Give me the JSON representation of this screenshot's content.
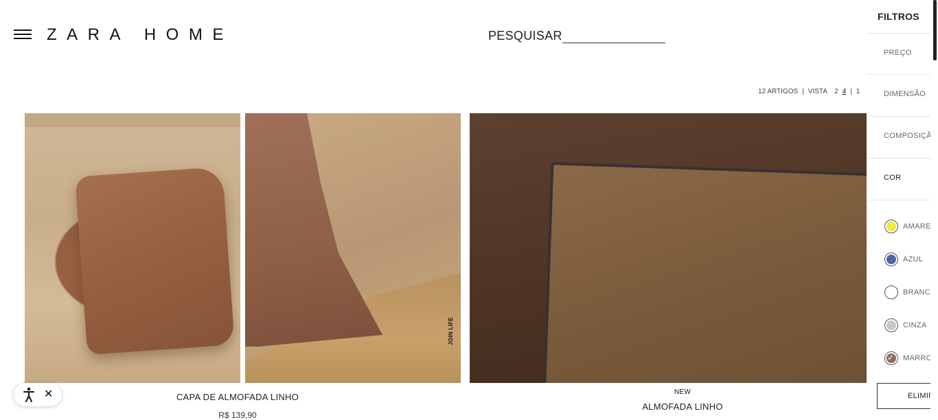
{
  "header": {
    "logo": "ZARA HOME",
    "search_label": "PESQUISAR"
  },
  "view_bar": {
    "count": "12 ARTIGOS",
    "separator": "|",
    "view_label": "VISTA",
    "options": [
      "2",
      "4",
      "1"
    ],
    "active_option": "4"
  },
  "products": [
    {
      "badge": "",
      "title": "CAPA DE ALMOFADA LINHO",
      "price": "R$ 139,90",
      "watermark": "JOIN LIFE"
    },
    {
      "badge": "NEW",
      "title": "ALMOFADA LINHO",
      "price": ""
    }
  ],
  "filters": {
    "title": "FILTROS",
    "sections": [
      "PREÇO",
      "DIMENSÃO",
      "COMPOSIÇÃO",
      "COR"
    ],
    "colors": [
      {
        "label": "AMARELO",
        "hex": "#f5e93a",
        "selected": false
      },
      {
        "label": "AZUL",
        "hex": "#4a68a8",
        "selected": false
      },
      {
        "label": "BRANCO",
        "hex": "#ffffff",
        "selected": false
      },
      {
        "label": "CINZA",
        "hex": "#c8c8c8",
        "selected": false
      },
      {
        "label": "MARROM",
        "hex": "#8b6f5e",
        "selected": true
      }
    ],
    "clear_label": "ELIMINAR"
  },
  "accessibility": {
    "icon": "accessibility-icon",
    "close": "✕"
  }
}
